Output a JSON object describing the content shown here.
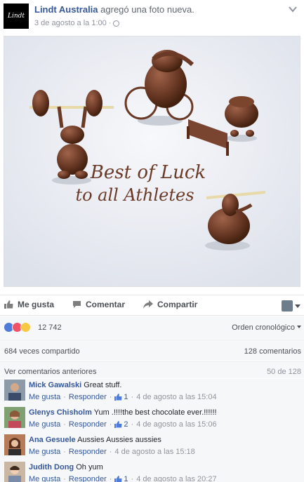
{
  "post": {
    "page_name": "Lindt Australia",
    "action": "agregó una foto nueva.",
    "timestamp": "3 de agosto a la 1:00",
    "avatar_text": "Lindt",
    "photo_text_line1": "Best of Luck",
    "photo_text_line2": "to all Athletes"
  },
  "actions": {
    "like": "Me gusta",
    "comment": "Comentar",
    "share": "Compartir"
  },
  "reactions": {
    "count": "12 742",
    "order": "Orden cronológico",
    "shared": "684 veces compartido",
    "comments": "128 comentarios"
  },
  "more_comments": {
    "label": "Ver comentarios anteriores",
    "count": "50 de 128"
  },
  "comment_meta": {
    "like": "Me gusta",
    "reply": "Responder"
  },
  "comments": [
    {
      "name": "Mick Gawalski",
      "text": "Great stuff.",
      "likes": "1",
      "time": "4 de agosto a las 15:04"
    },
    {
      "name": "Glenys Chisholm",
      "text": "Yum .!!!!the best chocolate ever.!!!!!!",
      "likes": "2",
      "time": "4 de agosto a las 15:06"
    },
    {
      "name": "Ana Gesuele",
      "text": "Aussies Aussies aussies",
      "likes": "",
      "time": "4 de agosto a las 15:18"
    },
    {
      "name": "Judith Dong",
      "text": "Oh yum",
      "likes": "1",
      "time": "4 de agosto a las 20:27"
    }
  ],
  "colors": {
    "link": "#365899",
    "muted": "#90949c",
    "panel": "#f6f7f9",
    "chocolate": "#6b3a26"
  }
}
